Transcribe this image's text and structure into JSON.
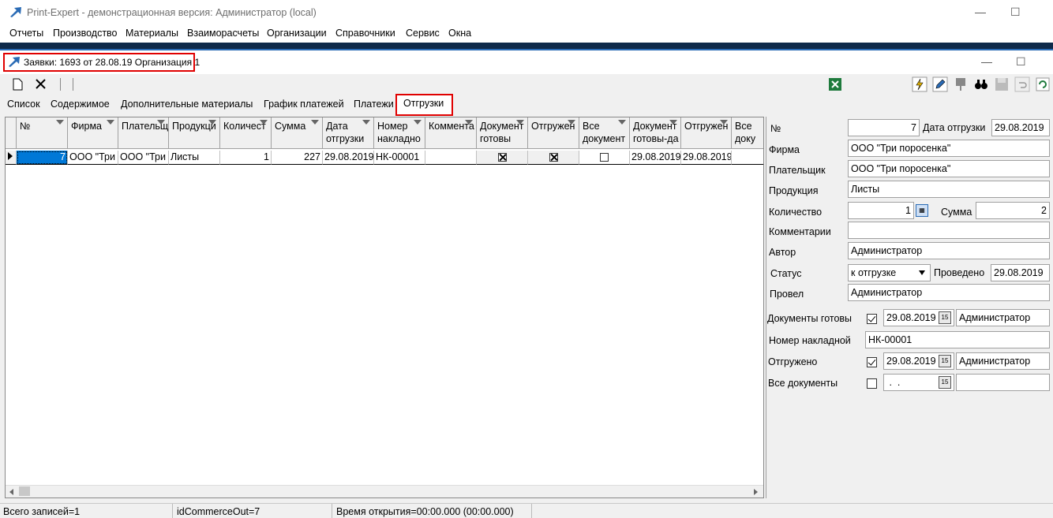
{
  "app": {
    "title": "Print-Expert - демонстрационная версия: Администратор (local)",
    "minimize": "—",
    "maximize": "☐"
  },
  "menu": [
    "Отчеты",
    "Производство",
    "Материалы",
    "Взаиморасчеты",
    "Организации",
    "Справочники",
    "Сервис",
    "Окна"
  ],
  "child_window": {
    "title": "Заявки: 1693 от 28.08.19  Организация 1"
  },
  "tabs": [
    "Список",
    "Содержимое",
    "Дополнительные материалы",
    "График платежей",
    "Платежи",
    "Отгрузки"
  ],
  "active_tab": "Отгрузки",
  "grid": {
    "headers": [
      "№",
      "Фирма",
      "Плательщ",
      "Продукци",
      "Количест",
      "Сумма",
      "Дата\nотгрузки",
      "Номер\nнакладно",
      "Коммента",
      "Документ\nготовы",
      "Отгружен",
      "Все\nдокумент",
      "Документ\nготовы-да",
      "Отгружен",
      "Все\nдоку"
    ],
    "row": {
      "num": "7",
      "firm": "ООО \"Три",
      "payer": "ООО \"Три",
      "product": "Листы",
      "qty": "1",
      "sum": "227",
      "ship_date": "29.08.2019",
      "invoice": "НК-00001",
      "comment": "",
      "docs_ready_date": "29.08.2019",
      "shipped_date": "29.08.2019"
    }
  },
  "panel": {
    "num_label": "№",
    "num_value": "7",
    "ship_date_label": "Дата отгрузки",
    "ship_date_value": "29.08.2019",
    "firm_label": "Фирма",
    "firm_value": "ООО \"Три поросенка\"",
    "payer_label": "Плательщик",
    "payer_value": "ООО \"Три поросенка\"",
    "product_label": "Продукция",
    "product_value": "Листы",
    "qty_label": "Количество",
    "qty_value": "1",
    "sum_label": "Сумма",
    "sum_value": "2",
    "comment_label": "Комментарии",
    "comment_value": "",
    "author_label": "Автор",
    "author_value": "Администратор",
    "status_label": "Статус",
    "status_value": "к отгрузке",
    "posted_label": "Проведено",
    "posted_value": "29.08.2019",
    "poster_label": "Провел",
    "poster_value": "Администратор",
    "docs_ready_label": "Документы готовы",
    "docs_ready_date": "29.08.2019",
    "docs_ready_user": "Администратор",
    "invoice_label": "Номер накладной",
    "invoice_value": "НК-00001",
    "shipped_label": "Отгружено",
    "shipped_date": "29.08.2019",
    "shipped_user": "Администратор",
    "all_docs_label": "Все документы",
    "all_docs_date": " .  .",
    "all_docs_user": ""
  },
  "status": {
    "records": "Всего записей=1",
    "id": "idCommerceOut=7",
    "time": "Время открытия=00:00.000 (00:00.000)"
  },
  "colors": {
    "highlight": "#e00000",
    "selection": "#0078d7",
    "dark_strip": "#0f2a4a"
  }
}
